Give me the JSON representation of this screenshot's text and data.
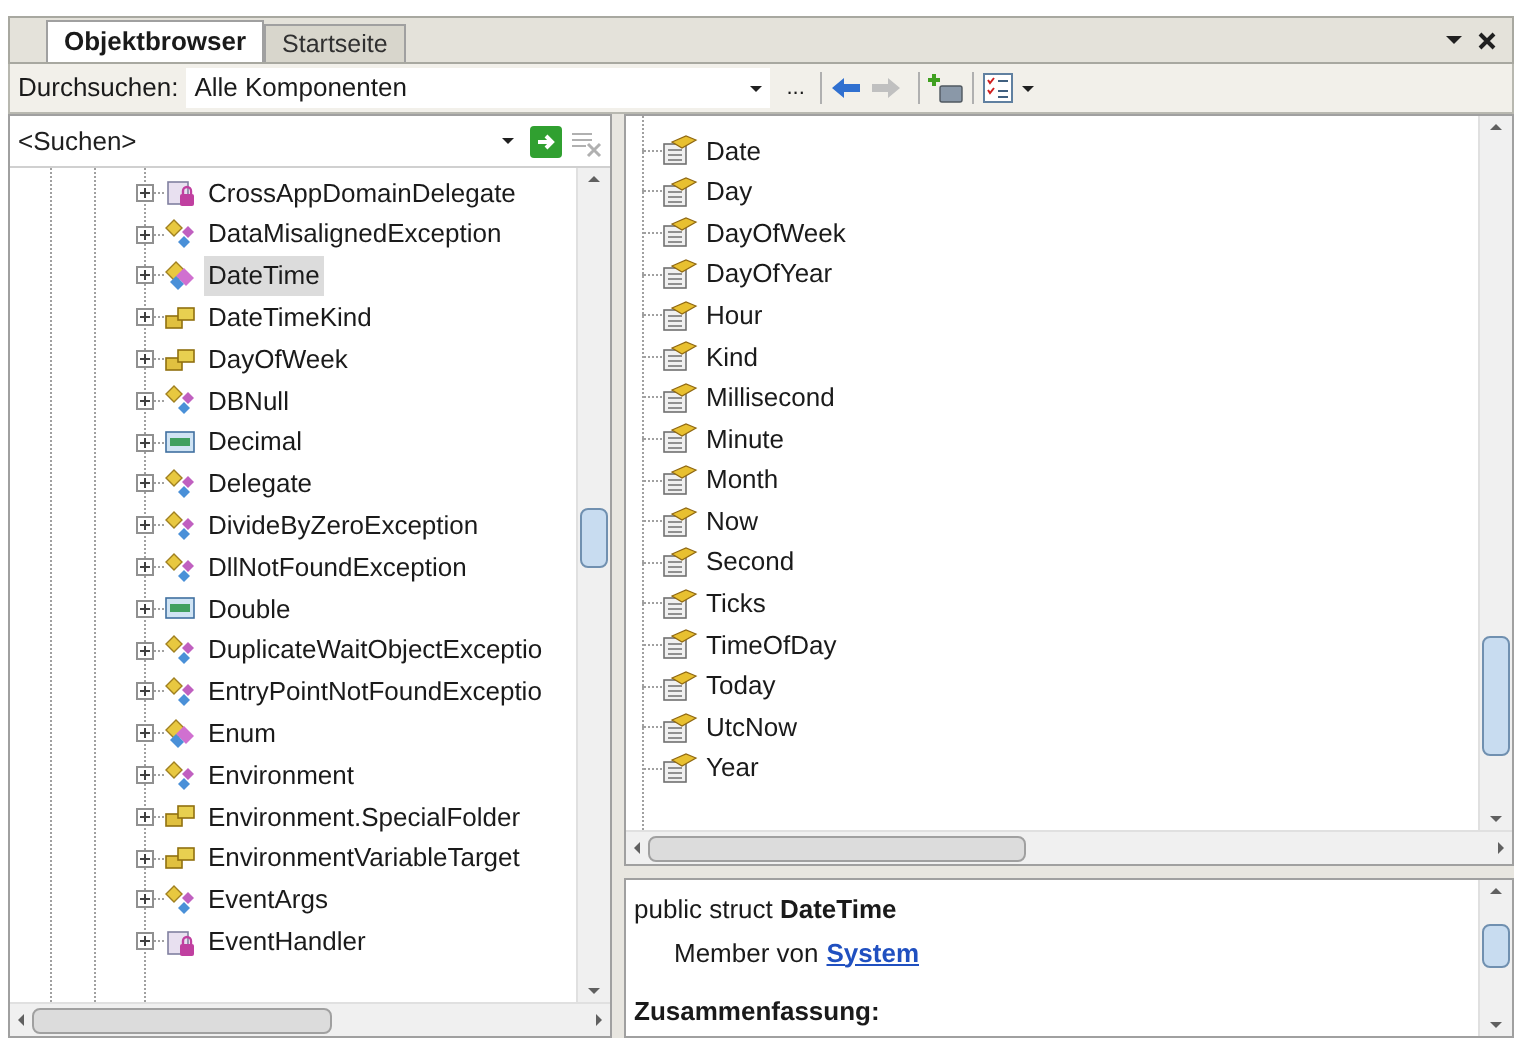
{
  "tabs": [
    {
      "label": "Objektbrowser",
      "selected": true
    },
    {
      "label": "Startseite",
      "selected": false
    }
  ],
  "toolbar": {
    "browse_label": "Durchsuchen:",
    "browse_value": "Alle Komponenten",
    "more_button": "...",
    "back_enabled": true,
    "forward_enabled": false
  },
  "search": {
    "placeholder": "<Suchen>"
  },
  "types": [
    {
      "name": "CrossAppDomainDelegate",
      "kind": "delegate",
      "selected": false
    },
    {
      "name": "DataMisalignedException",
      "kind": "class",
      "selected": false
    },
    {
      "name": "DateTime",
      "kind": "struct",
      "selected": true
    },
    {
      "name": "DateTimeKind",
      "kind": "enum",
      "selected": false
    },
    {
      "name": "DayOfWeek",
      "kind": "enum",
      "selected": false
    },
    {
      "name": "DBNull",
      "kind": "class",
      "selected": false
    },
    {
      "name": "Decimal",
      "kind": "primitive",
      "selected": false
    },
    {
      "name": "Delegate",
      "kind": "class",
      "selected": false
    },
    {
      "name": "DivideByZeroException",
      "kind": "class",
      "selected": false
    },
    {
      "name": "DllNotFoundException",
      "kind": "class",
      "selected": false
    },
    {
      "name": "Double",
      "kind": "primitive",
      "selected": false
    },
    {
      "name": "DuplicateWaitObjectExceptio",
      "kind": "class",
      "selected": false
    },
    {
      "name": "EntryPointNotFoundExceptio",
      "kind": "class",
      "selected": false
    },
    {
      "name": "Enum",
      "kind": "struct",
      "selected": false
    },
    {
      "name": "Environment",
      "kind": "class",
      "selected": false
    },
    {
      "name": "Environment.SpecialFolder",
      "kind": "enum",
      "selected": false
    },
    {
      "name": "EnvironmentVariableTarget",
      "kind": "enum",
      "selected": false
    },
    {
      "name": "EventArgs",
      "kind": "class",
      "selected": false
    },
    {
      "name": "EventHandler",
      "kind": "delegate",
      "selected": false
    }
  ],
  "members": [
    "Date",
    "Day",
    "DayOfWeek",
    "DayOfYear",
    "Hour",
    "Kind",
    "Millisecond",
    "Minute",
    "Month",
    "Now",
    "Second",
    "Ticks",
    "TimeOfDay",
    "Today",
    "UtcNow",
    "Year"
  ],
  "description": {
    "signature": "public struct **DateTime**",
    "member_of": "Member von",
    "namespace_link": "System",
    "section_heading": "Zusammenfassung:"
  }
}
